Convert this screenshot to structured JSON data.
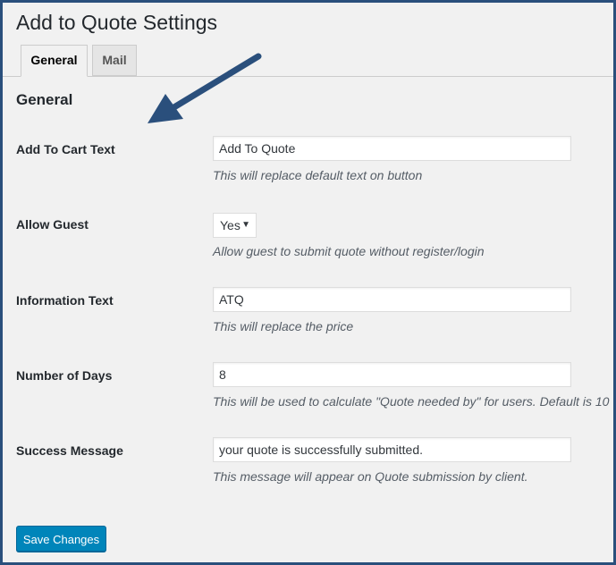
{
  "page": {
    "title": "Add to Quote Settings"
  },
  "tabs": [
    {
      "label": "General",
      "active": true
    },
    {
      "label": "Mail",
      "active": false
    }
  ],
  "section": {
    "title": "General"
  },
  "fields": {
    "add_to_cart_text": {
      "label": "Add To Cart Text",
      "value": "Add To Quote",
      "description": "This will replace default text on button"
    },
    "allow_guest": {
      "label": "Allow Guest",
      "selected": "Yes",
      "description": "Allow guest to submit quote without register/login"
    },
    "information_text": {
      "label": "Information Text",
      "value": "ATQ",
      "description": "This will replace the price"
    },
    "number_of_days": {
      "label": "Number of Days",
      "value": "8",
      "description": "This will be used to calculate \"Quote needed by\" for users. Default is 10"
    },
    "success_message": {
      "label": "Success Message",
      "value": "your quote is successfully submitted.",
      "description": "This message will appear on Quote submission by client."
    }
  },
  "actions": {
    "save_label": "Save Changes"
  },
  "colors": {
    "frame_border": "#2a4f7c",
    "arrow": "#2a4f7c",
    "primary_button": "#0085ba",
    "background": "#f1f1f1"
  }
}
